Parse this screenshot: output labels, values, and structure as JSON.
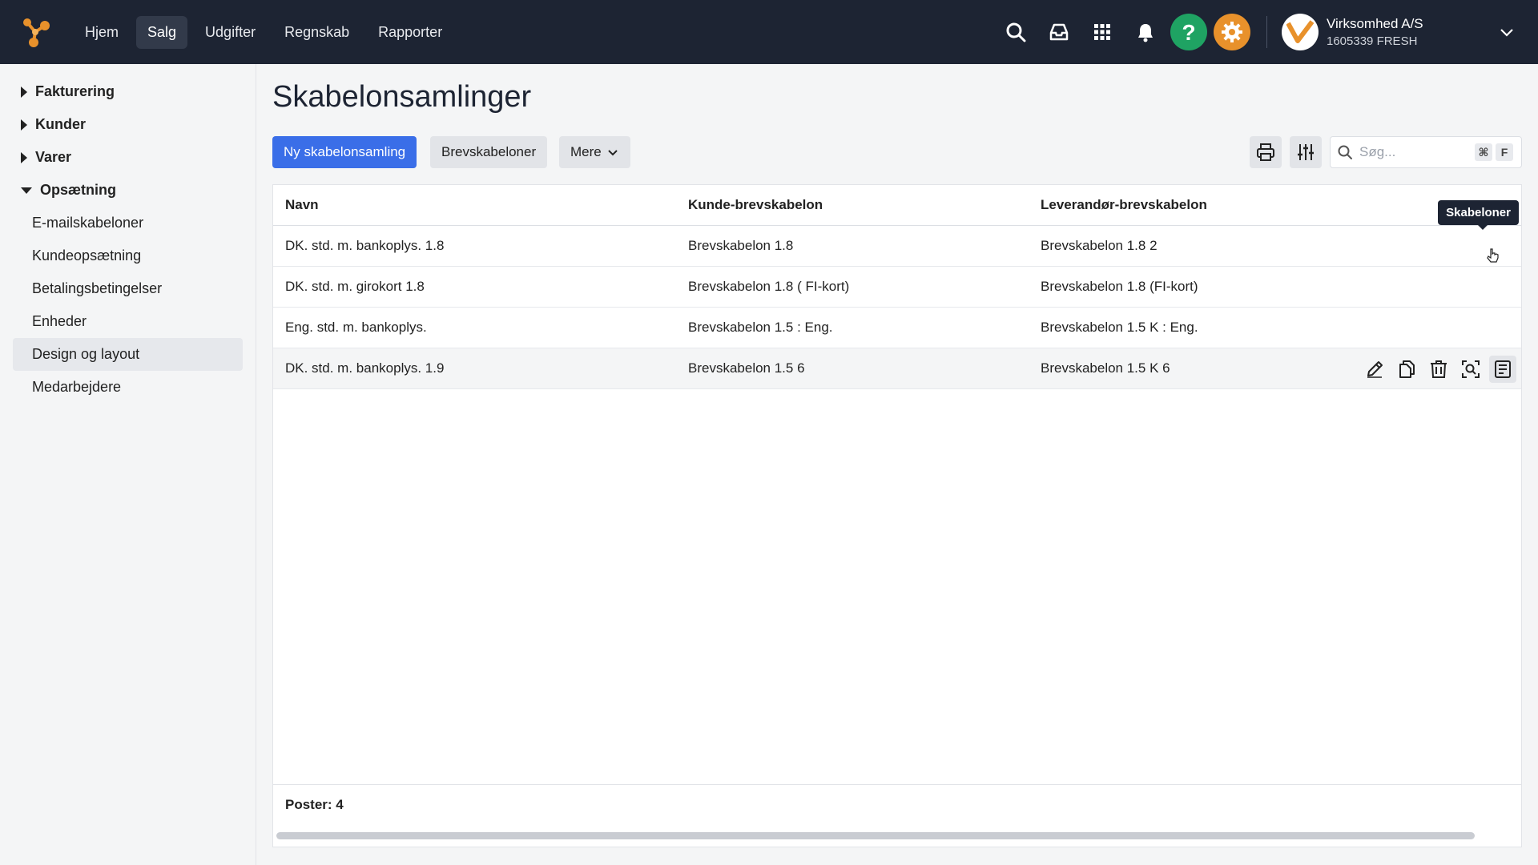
{
  "topbar": {
    "nav": [
      "Hjem",
      "Salg",
      "Udgifter",
      "Regnskab",
      "Rapporter"
    ],
    "active_nav": "Salg",
    "company_name": "Virksomhed A/S",
    "company_id": "1605339 FRESH",
    "colors": {
      "background": "#1d2433",
      "help": "#1fa363",
      "settings": "#e8912b"
    }
  },
  "sidebar": {
    "groups": [
      {
        "label": "Fakturering",
        "expanded": false
      },
      {
        "label": "Kunder",
        "expanded": false
      },
      {
        "label": "Varer",
        "expanded": false
      },
      {
        "label": "Opsætning",
        "expanded": true
      }
    ],
    "items": [
      "E-mailskabeloner",
      "Kundeopsætning",
      "Betalingsbetingelser",
      "Enheder",
      "Design og layout",
      "Medarbejdere"
    ],
    "active_item": "Design og layout"
  },
  "page": {
    "title": "Skabelonsamlinger",
    "new_button": "Ny skabelonsamling",
    "letter_templates_button": "Brevskabeloner",
    "more_button": "Mere",
    "search_placeholder": "Søg...",
    "shortcut_cmd": "⌘",
    "shortcut_key": "F"
  },
  "table": {
    "columns": [
      "Navn",
      "Kunde-brevskabelon",
      "Leverandør-brevskabelon"
    ],
    "rows": [
      [
        "DK. std. m. bankoplys. 1.8",
        "Brevskabelon 1.8",
        "Brevskabelon 1.8 2"
      ],
      [
        "DK. std. m. girokort 1.8",
        "Brevskabelon 1.8 ( FI-kort)",
        "Brevskabelon 1.8 (FI-kort)"
      ],
      [
        "Eng. std. m. bankoplys.",
        "Brevskabelon 1.5 : Eng.",
        "Brevskabelon 1.5 K : Eng."
      ],
      [
        "DK. std. m. bankoplys. 1.9",
        "Brevskabelon 1.5 6",
        "Brevskabelon 1.5 K 6"
      ]
    ],
    "hovered_row": 3,
    "tooltip": "Skabeloner",
    "footer": "Poster: 4"
  }
}
